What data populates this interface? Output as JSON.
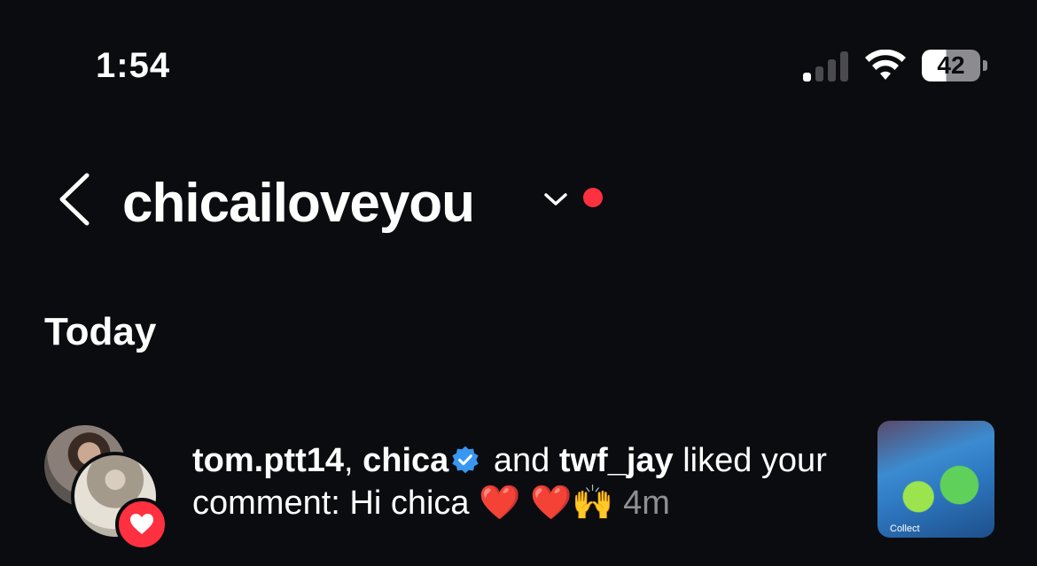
{
  "status_bar": {
    "time": "1:54",
    "battery_level": "42",
    "signal_bars_active": 1,
    "signal_bars_total": 4
  },
  "header": {
    "account_name": "chicailoveyou",
    "unread_dot_color": "#ff3040"
  },
  "section": {
    "title": "Today"
  },
  "notification": {
    "user1": "tom.ptt14",
    "separator": ", ",
    "user2": "chica",
    "conjunction": " and ",
    "user3": "twf_jay",
    "action": " liked your comment: ",
    "comment": "Hi chica ❤️ ❤️🙌",
    "time_ago": "4m",
    "thumbnail_text": "Collect",
    "badge_icon": "heart-icon",
    "verified_icon": "verified-badge-icon"
  },
  "colors": {
    "background": "#0b0c10",
    "accent_red": "#ff3040",
    "verified_blue": "#3897f0",
    "secondary_text": "#8e8e93"
  }
}
